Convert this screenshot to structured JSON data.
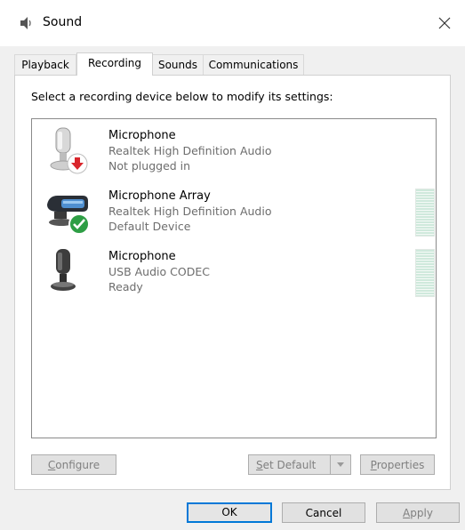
{
  "window": {
    "title": "Sound"
  },
  "tabs": [
    {
      "label": "Playback"
    },
    {
      "label": "Recording"
    },
    {
      "label": "Sounds"
    },
    {
      "label": "Communications"
    }
  ],
  "panel": {
    "instruction": "Select a recording device below to modify its settings:"
  },
  "devices": [
    {
      "name": "Microphone",
      "driver": "Realtek High Definition Audio",
      "status": "Not plugged in",
      "badge": "red-down-arrow-icon"
    },
    {
      "name": "Microphone Array",
      "driver": "Realtek High Definition Audio",
      "status": "Default Device",
      "badge": "green-check-icon"
    },
    {
      "name": "Microphone",
      "driver": "USB Audio CODEC",
      "status": "Ready",
      "badge": ""
    }
  ],
  "buttons": {
    "configure_first": "C",
    "configure_rest": "onfigure",
    "set_default_first": "S",
    "set_default_rest": "et Default",
    "properties_first": "P",
    "properties_rest": "roperties",
    "ok": "OK",
    "cancel": "Cancel",
    "apply_first": "A",
    "apply_rest": "pply"
  },
  "colors": {
    "accent": "#0078d7",
    "check": "#2e9e45",
    "unplugged": "#d9262c"
  }
}
